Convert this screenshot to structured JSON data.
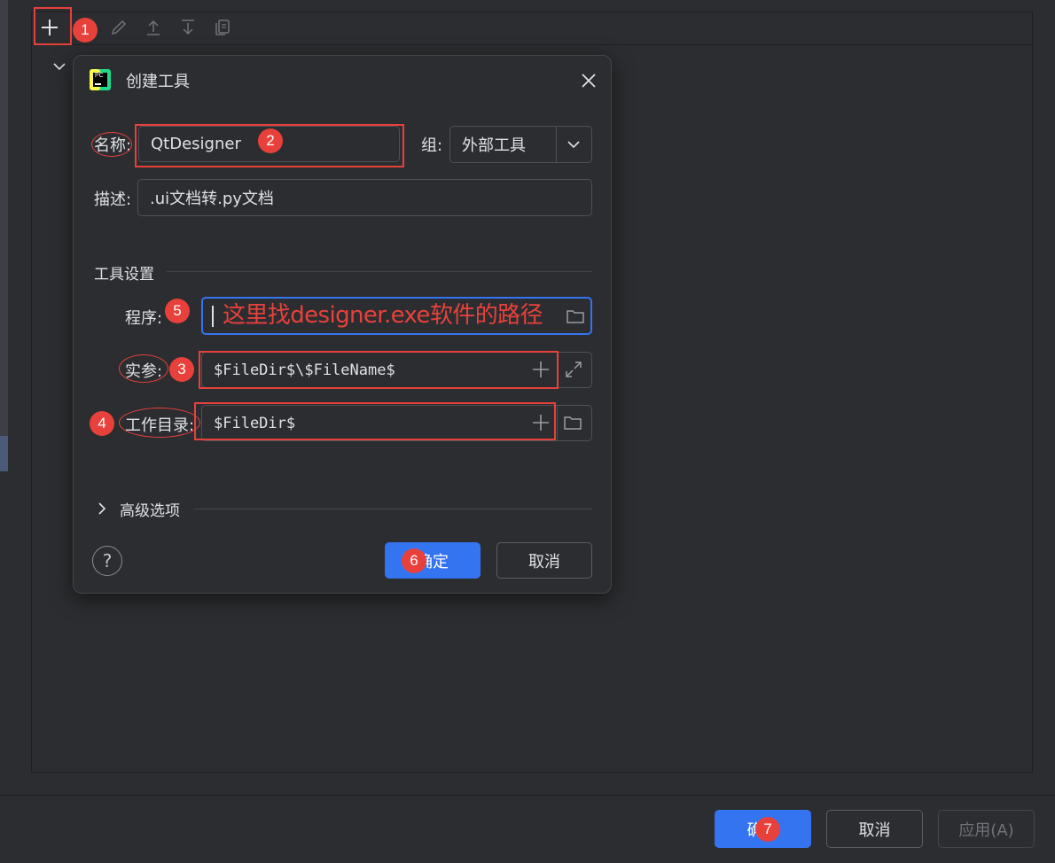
{
  "dialog": {
    "title": "创建工具",
    "logo_text": "PC",
    "name_label": "名称:",
    "name_value": "QtDesigner",
    "group_label": "组:",
    "group_value": "外部工具",
    "desc_label": "描述:",
    "desc_value": ".ui文档转.py文档",
    "section_title": "工具设置",
    "program_label": "程序:",
    "program_annotation": "这里找designer.exe软件的路径",
    "args_label": "实参:",
    "args_value": "$FileDir$\\$FileName$",
    "workdir_label": "工作目录:",
    "workdir_value": "$FileDir$",
    "advanced_label": "高级选项",
    "help_label": "?",
    "ok_label": "确定",
    "cancel_label": "取消"
  },
  "footer": {
    "ok_label": "确定",
    "cancel_label": "取消",
    "apply_label": "应用(A)"
  },
  "badges": [
    "1",
    "2",
    "3",
    "4",
    "5",
    "6",
    "7"
  ],
  "colors": {
    "background": "#2b2d30",
    "primary": "#3574f0",
    "annotation": "#e8413b",
    "focus": "#3574f0"
  },
  "icons": [
    "add-icon",
    "edit-icon",
    "move-up-icon",
    "move-down-icon",
    "copy-icon",
    "chevron-down-icon",
    "close-icon",
    "folder-icon",
    "expand-icon",
    "chevron-right-icon",
    "help-icon"
  ]
}
